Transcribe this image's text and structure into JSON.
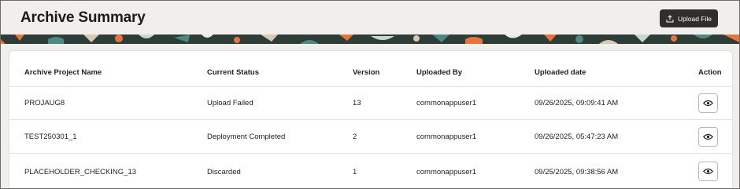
{
  "header": {
    "title": "Archive Summary",
    "upload_label": "Upload File",
    "upload_icon": "upload-icon"
  },
  "colors": {
    "header_bg": "#f1efec",
    "button_bg": "#312d2a",
    "banner_dark": "#2d3a36",
    "banner_orange": "#e8743b",
    "banner_teal": "#4b8a82"
  },
  "table": {
    "columns": [
      "Archive Project Name",
      "Current Status",
      "Version",
      "Uploaded By",
      "Uploaded date",
      "Action"
    ],
    "rows": [
      {
        "name": "PROJAUG8",
        "status": "Upload Failed",
        "version": "13",
        "uploaded_by": "commonappuser1",
        "uploaded_date": "09/26/2025, 09:09:41 AM",
        "action_icon": "eye-icon"
      },
      {
        "name": "TEST250301_1",
        "status": "Deployment Completed",
        "version": "2",
        "uploaded_by": "commonappuser1",
        "uploaded_date": "09/26/2025, 05:47:23 AM",
        "action_icon": "eye-icon"
      },
      {
        "name": "PLACEHOLDER_CHECKING_13",
        "status": "Discarded",
        "version": "1",
        "uploaded_by": "commonappuser1",
        "uploaded_date": "09/25/2025, 09:38:56 AM",
        "action_icon": "eye-icon"
      }
    ]
  }
}
